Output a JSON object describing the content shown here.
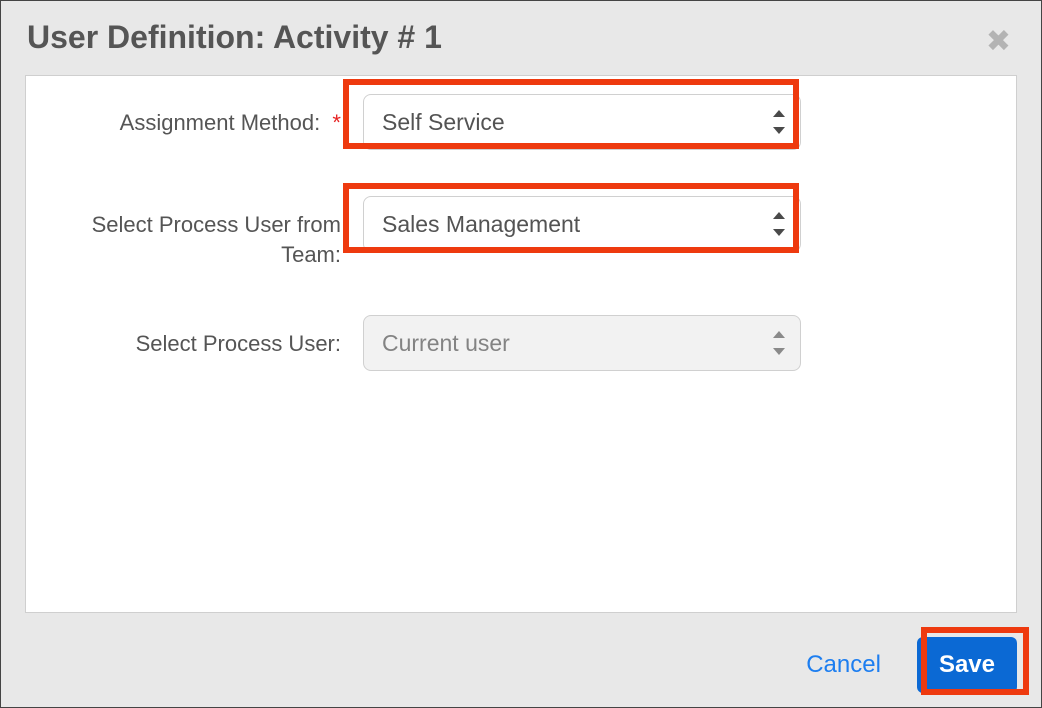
{
  "dialog": {
    "title": "User Definition: Activity # 1"
  },
  "form": {
    "rows": [
      {
        "label": "Assignment Method:",
        "required": true,
        "value": "Self Service",
        "disabled": false,
        "highlight": true
      },
      {
        "label": "Select Process User from Team:",
        "required": false,
        "value": "Sales Management",
        "disabled": false,
        "highlight": true
      },
      {
        "label": "Select Process User:",
        "required": false,
        "value": "Current user",
        "disabled": true,
        "highlight": false
      }
    ]
  },
  "footer": {
    "cancel": "Cancel",
    "save": "Save",
    "save_highlight": true
  }
}
